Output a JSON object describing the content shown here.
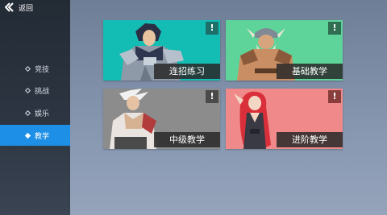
{
  "header": {
    "back_label": "返回"
  },
  "sidebar": {
    "items": [
      {
        "label": "竞技",
        "active": false
      },
      {
        "label": "挑战",
        "active": false
      },
      {
        "label": "娱乐",
        "active": false
      },
      {
        "label": "教学",
        "active": true
      }
    ]
  },
  "cards": [
    {
      "label": "连招练习",
      "badge": "!",
      "bg": "#14bdb4",
      "badge_bg": "#1d6f6a",
      "character": "armored-swordsman"
    },
    {
      "label": "基础教学",
      "badge": "!",
      "bg": "#5fd49a",
      "badge_bg": "#2f6e50",
      "character": "viking-warrior"
    },
    {
      "label": "中级教学",
      "badge": "!",
      "bg": "#8c8c8c",
      "badge_bg": "#4a4a4a",
      "character": "silver-haired-fighter"
    },
    {
      "label": "进阶教学",
      "badge": "!",
      "bg": "#f08a8a",
      "badge_bg": "#8a3d3d",
      "character": "red-haired-woman"
    }
  ]
}
